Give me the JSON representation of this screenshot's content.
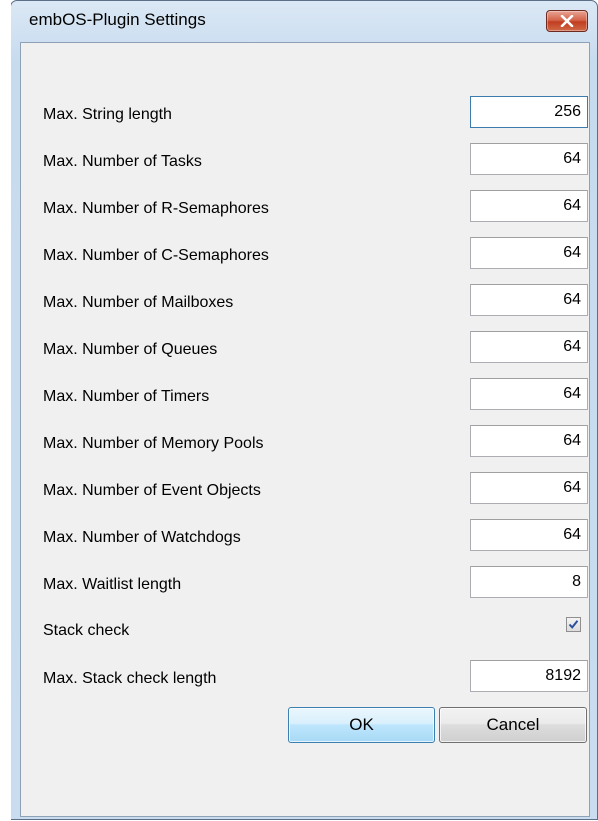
{
  "window": {
    "title": "embOS-Plugin Settings"
  },
  "settings": [
    {
      "label": "Max. String length",
      "value": "256"
    },
    {
      "label": "Max. Number of Tasks",
      "value": "64"
    },
    {
      "label": "Max. Number of R-Semaphores",
      "value": "64"
    },
    {
      "label": "Max. Number of C-Semaphores",
      "value": "64"
    },
    {
      "label": "Max. Number of Mailboxes",
      "value": "64"
    },
    {
      "label": "Max. Number of Queues",
      "value": "64"
    },
    {
      "label": "Max. Number of Timers",
      "value": "64"
    },
    {
      "label": "Max. Number of Memory Pools",
      "value": "64"
    },
    {
      "label": "Max. Number of Event Objects",
      "value": "64"
    },
    {
      "label": "Max. Number of Watchdogs",
      "value": "64"
    },
    {
      "label": "Max. Waitlist length",
      "value": "8"
    }
  ],
  "stack_check": {
    "label": "Stack check",
    "checked": true
  },
  "stack_check_length": {
    "label": "Max. Stack check length",
    "value": "8192"
  },
  "buttons": {
    "ok": "OK",
    "cancel": "Cancel"
  }
}
